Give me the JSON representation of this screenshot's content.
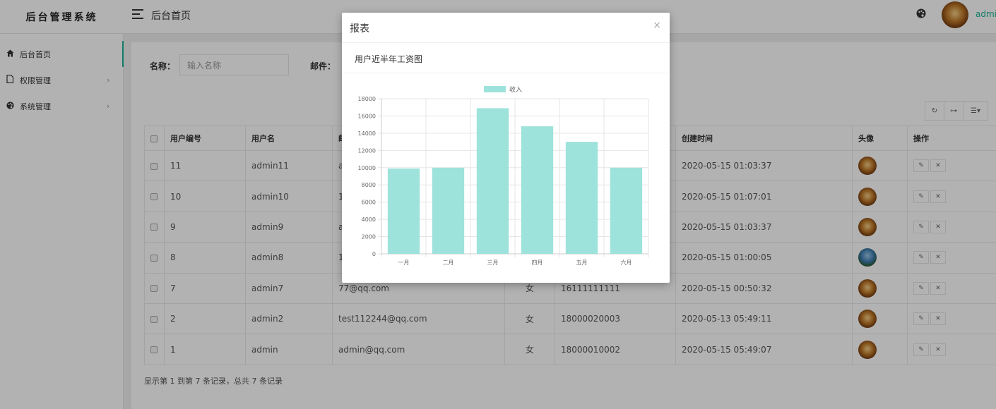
{
  "app": {
    "logo_text": "后台管理系统",
    "top_title": "后台首页",
    "user_name": "admi"
  },
  "sidebar": {
    "items": [
      {
        "label": "后台首页",
        "icon": "home-icon",
        "arrow": ""
      },
      {
        "label": "权限管理",
        "icon": "file-icon",
        "arrow": "›"
      },
      {
        "label": "系统管理",
        "icon": "palette-icon",
        "arrow": "›"
      }
    ]
  },
  "search": {
    "name_label": "名称：",
    "name_placeholder": "输入名称",
    "email_label": "邮件："
  },
  "table": {
    "headers": [
      "用户编号",
      "用户名",
      "邮",
      "",
      "",
      "创建时间",
      "头像",
      "操作"
    ],
    "rows": [
      {
        "id": "11",
        "username": "admin11",
        "email": "a",
        "gender": "",
        "phone": "",
        "created": "2020-05-15 01:03:37",
        "avatar": "orange"
      },
      {
        "id": "10",
        "username": "admin10",
        "email": "1",
        "gender": "",
        "phone": "",
        "created": "2020-05-15 01:07:01",
        "avatar": "orange"
      },
      {
        "id": "9",
        "username": "admin9",
        "email": "a",
        "gender": "",
        "phone": "",
        "created": "2020-05-15 01:03:37",
        "avatar": "orange"
      },
      {
        "id": "8",
        "username": "admin8",
        "email": "1",
        "gender": "",
        "phone": "",
        "created": "2020-05-15 01:00:05",
        "avatar": "blue"
      },
      {
        "id": "7",
        "username": "admin7",
        "email": "77@qq.com",
        "gender": "女",
        "phone": "16111111111",
        "created": "2020-05-15 00:50:32",
        "avatar": "orange"
      },
      {
        "id": "2",
        "username": "admin2",
        "email": "test112244@qq.com",
        "gender": "女",
        "phone": "18000020003",
        "created": "2020-05-13 05:49:11",
        "avatar": "orange"
      },
      {
        "id": "1",
        "username": "admin",
        "email": "admin@qq.com",
        "gender": "女",
        "phone": "18000010002",
        "created": "2020-05-15 05:49:07",
        "avatar": "orange"
      }
    ],
    "footer": "显示第 1 到第 7 条记录，总共 7 条记录"
  },
  "toolbar": {
    "refresh_icon": "refresh-icon",
    "key_icon": "key-icon",
    "columns_icon": "list-icon"
  },
  "modal": {
    "title": "报表",
    "close_symbol": "×",
    "chart_heading": "用户近半年工资图"
  },
  "chart_data": {
    "type": "bar",
    "categories": [
      "一月",
      "二月",
      "三月",
      "四月",
      "五月",
      "六月"
    ],
    "series": [
      {
        "name": "收入",
        "values": [
          9900,
          10000,
          16900,
          14800,
          13000,
          10000
        ]
      }
    ],
    "ylim": [
      0,
      18000
    ],
    "yticks": [
      0,
      2000,
      4000,
      6000,
      8000,
      10000,
      12000,
      14000,
      16000,
      18000
    ],
    "bar_color": "#9de3dc",
    "grid": true,
    "legend": "top-center"
  }
}
